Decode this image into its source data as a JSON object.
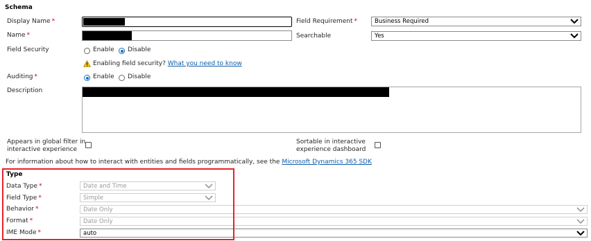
{
  "schema": {
    "title": "Schema",
    "display_name": {
      "label": "Display Name",
      "required": "*"
    },
    "name": {
      "label": "Name",
      "required": "*"
    },
    "field_requirement": {
      "label": "Field Requirement",
      "required": "*",
      "value": "Business Required"
    },
    "searchable": {
      "label": "Searchable",
      "value": "Yes"
    },
    "field_security": {
      "label": "Field Security",
      "option_enable": "Enable",
      "option_disable": "Disable",
      "selected": "Disable",
      "warning_text": "Enabling field security?",
      "warning_link": "What you need to know"
    },
    "auditing": {
      "label": "Auditing",
      "required": "*",
      "option_enable": "Enable",
      "option_disable": "Disable",
      "selected": "Enable"
    },
    "description": {
      "label": "Description"
    },
    "global_filter": {
      "label_line1": "Appears in global filter in",
      "label_line2": "interactive experience",
      "checked": false
    },
    "sortable": {
      "label_line1": "Sortable in interactive",
      "label_line2": "experience dashboard",
      "checked": false
    },
    "info_text": "For information about how to interact with entities and fields programmatically, see the",
    "info_link": "Microsoft Dynamics 365 SDK"
  },
  "type": {
    "title": "Type",
    "data_type": {
      "label": "Data Type",
      "required": "*",
      "value": "Date and Time"
    },
    "field_type": {
      "label": "Field Type",
      "required": "*",
      "value": "Simple"
    },
    "behavior": {
      "label": "Behavior",
      "required": "*",
      "value": "Date Only"
    },
    "format": {
      "label": "Format",
      "required": "*",
      "value": "Date Only"
    },
    "ime_mode": {
      "label": "IME Mode",
      "required": "*",
      "value": "auto"
    }
  },
  "colors": {
    "required": "#d0021b",
    "link": "#0f5ca8",
    "highlight_box": "#e8202a",
    "radio_selected": "#106ebe"
  }
}
